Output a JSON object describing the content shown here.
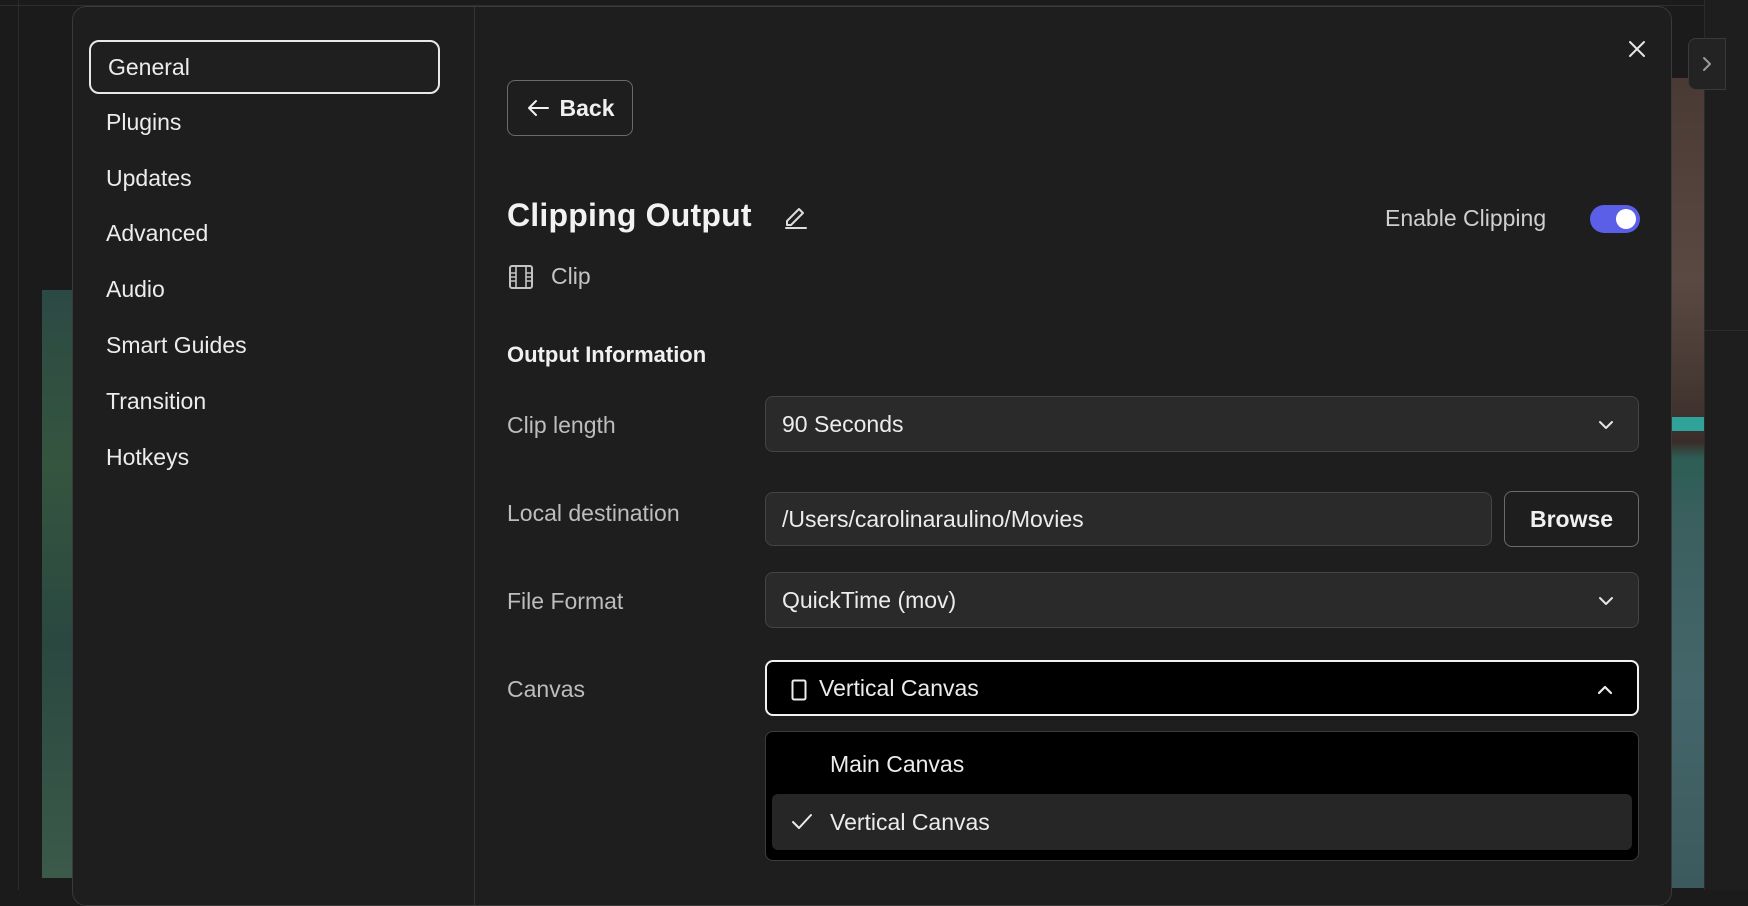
{
  "colors": {
    "accent_toggle": "#5b5ee6",
    "modal_bg": "#1e1e1e",
    "dropdown_bg": "#000000"
  },
  "sidebar": {
    "items": [
      {
        "label": "General",
        "active": true
      },
      {
        "label": "Plugins",
        "active": false
      },
      {
        "label": "Updates",
        "active": false
      },
      {
        "label": "Advanced",
        "active": false
      },
      {
        "label": "Audio",
        "active": false
      },
      {
        "label": "Smart Guides",
        "active": false
      },
      {
        "label": "Transition",
        "active": false
      },
      {
        "label": "Hotkeys",
        "active": false
      }
    ]
  },
  "header": {
    "back_label": "Back",
    "title": "Clipping Output",
    "type_label": "Clip",
    "enable_label": "Enable Clipping",
    "enable_on": true
  },
  "section": {
    "title": "Output Information"
  },
  "fields": {
    "clip_length": {
      "label": "Clip length",
      "value": "90 Seconds"
    },
    "local_destination": {
      "label": "Local destination",
      "value": "/Users/carolinaraulino/Movies",
      "button": "Browse"
    },
    "file_format": {
      "label": "File Format",
      "value": "QuickTime (mov)"
    },
    "canvas": {
      "label": "Canvas",
      "value": "Vertical Canvas",
      "options": [
        {
          "label": "Main Canvas",
          "selected": false
        },
        {
          "label": "Vertical Canvas",
          "selected": true
        }
      ]
    }
  },
  "icons": [
    "close-icon",
    "arrow-left-icon",
    "pencil-icon",
    "film-icon",
    "chevron-down-icon",
    "chevron-up-icon",
    "phone-icon",
    "check-icon",
    "chevron-right-icon"
  ]
}
